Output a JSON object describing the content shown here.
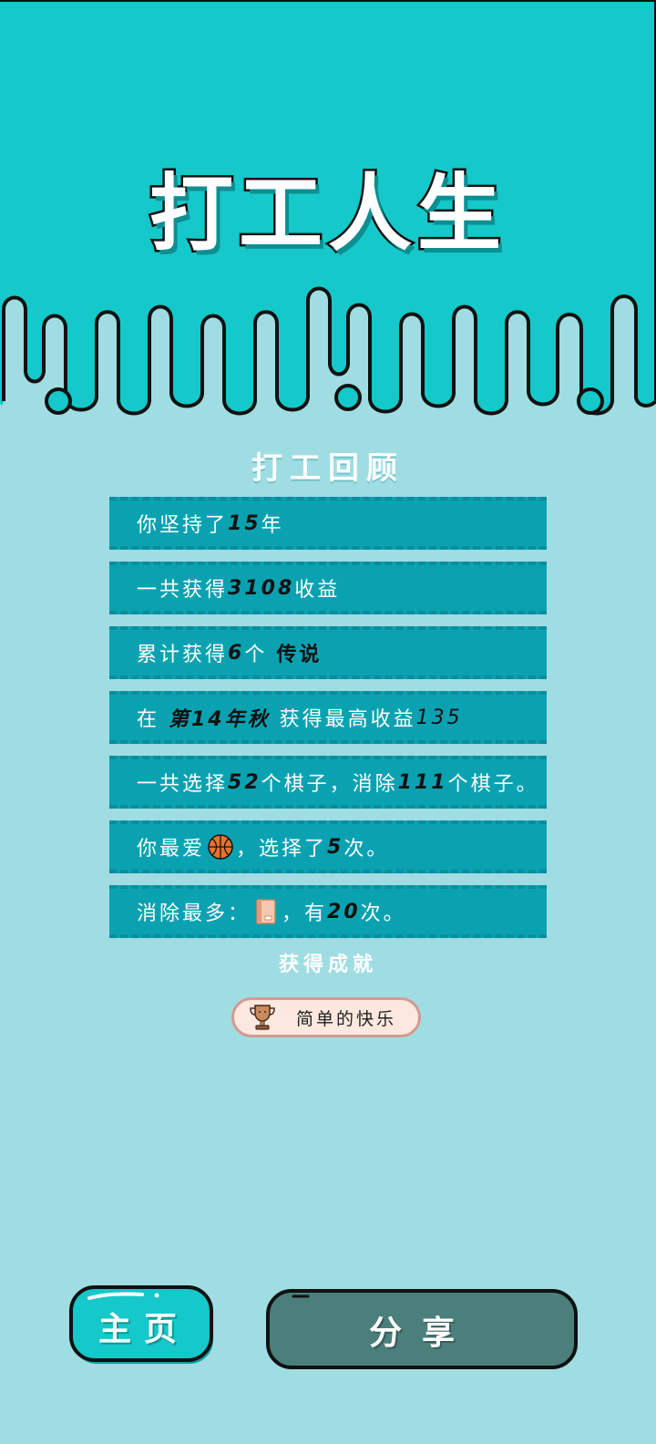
{
  "header": {
    "title": "打工人生"
  },
  "review": {
    "title": "打工回顾",
    "rows": [
      {
        "pre": "你坚持了",
        "hl": "15",
        "post": "年"
      },
      {
        "pre": "一共获得",
        "hl": "3108",
        "post": "收益"
      },
      {
        "pre": "累计获得",
        "hl": "6",
        "mid": "个 ",
        "hl2": "传说"
      },
      {
        "pre": "在 ",
        "hl": "第14年秋",
        "mid": " 获得最高收益",
        "hl2": "135"
      },
      {
        "pre": "一共选择",
        "hl": "52",
        "mid": "个棋子，消除",
        "hl2": "111",
        "post": "个棋子。"
      },
      {
        "pre": "你最爱",
        "icon": "basketball-icon",
        "mid": "，选择了",
        "hl2": "5",
        "post": "次。"
      },
      {
        "pre": "消除最多：",
        "icon": "book-icon",
        "mid": "，有",
        "hl2": "20",
        "post": "次。"
      }
    ]
  },
  "achievement": {
    "title": "获得成就",
    "badge_icon": "trophy-icon",
    "badge_label": "简单的快乐"
  },
  "buttons": {
    "home_label": "主页",
    "share_label": "分享"
  },
  "colors": {
    "top_bg": "#15c8c9",
    "page_bg": "#9fdde3",
    "row_bg": "#0aa2b1",
    "home_btn": "#15c8c9",
    "share_btn": "#4a7f7b"
  }
}
